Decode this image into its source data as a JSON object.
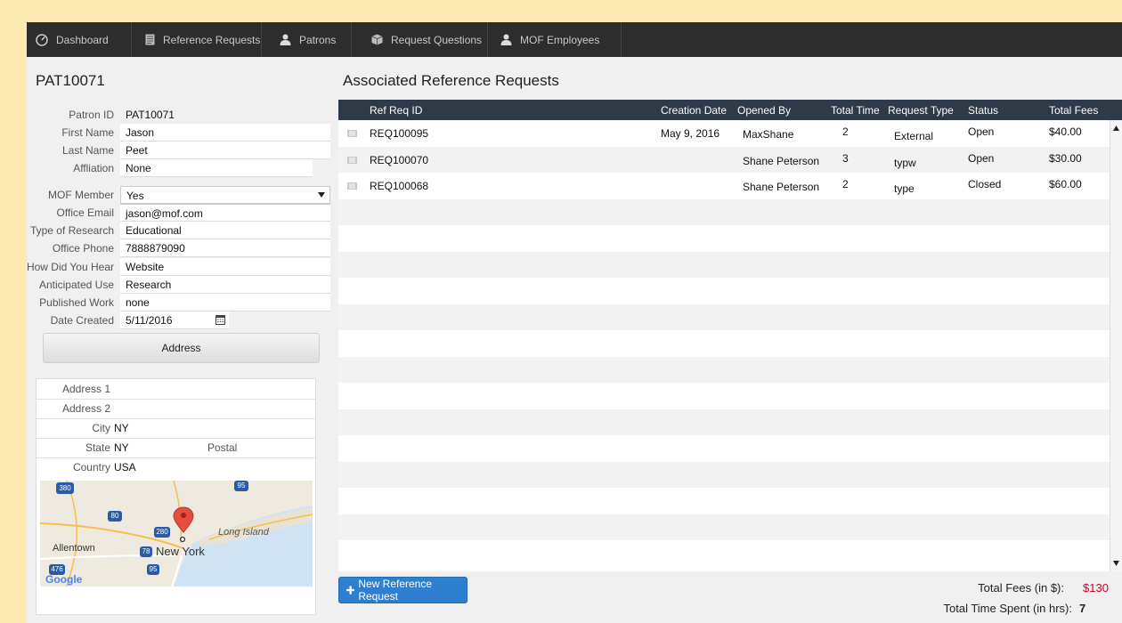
{
  "nav": {
    "items": [
      {
        "label": "Dashboard",
        "icon": "dashboard-icon"
      },
      {
        "label": "Reference Requests",
        "icon": "document-icon"
      },
      {
        "label": "Patrons",
        "icon": "person-icon"
      },
      {
        "label": "Request Questions",
        "icon": "box-icon"
      },
      {
        "label": "MOF Employees",
        "icon": "person-icon"
      }
    ]
  },
  "patron": {
    "title": "PAT10071",
    "fields": [
      {
        "label": "Patron ID",
        "value": "PAT10071"
      },
      {
        "label": "First Name",
        "value": "Jason"
      },
      {
        "label": "Last Name",
        "value": "Peet"
      },
      {
        "label": "Affliation",
        "value": "None"
      },
      {
        "label": "MOF Member",
        "value": "Yes"
      },
      {
        "label": "Office Email",
        "value": "jason@mof.com"
      },
      {
        "label": "Type of Research",
        "value": "Educational"
      },
      {
        "label": "Office Phone",
        "value": "7888879090"
      },
      {
        "label": "How Did You Hear",
        "value": "Website"
      },
      {
        "label": "Anticipated Use",
        "value": "Research"
      },
      {
        "label": "Published Work",
        "value": "none"
      },
      {
        "label": "Date Created",
        "value": "5/11/2016"
      }
    ],
    "address_button": "Address",
    "address": {
      "address1_label": "Address 1",
      "address1": "",
      "address2_label": "Address 2",
      "address2": "",
      "city_label": "City",
      "city": "NY",
      "state_label": "State",
      "state": "NY",
      "postal_label": "Postal",
      "postal": "",
      "country_label": "Country",
      "country": "USA"
    },
    "map": {
      "labels": [
        "Allentown",
        "New York",
        "Long Island",
        "Google"
      ],
      "shields": [
        "380",
        "95",
        "80",
        "280",
        "78",
        "476",
        "95"
      ]
    }
  },
  "requests": {
    "title": "Associated Reference Requests",
    "columns": [
      "Ref Req ID",
      "Creation Date",
      "Opened By",
      "Total Time",
      "Request Type",
      "Status",
      "Total Fees"
    ],
    "rows": [
      [
        "REQ100095",
        "May 9, 2016",
        "MaxShane",
        "2",
        "External",
        "Open",
        "$40.00"
      ],
      [
        "REQ100070",
        "",
        "Shane Peterson",
        "3",
        "typw",
        "Open",
        "$30.00"
      ],
      [
        "REQ100068",
        "",
        "Shane Peterson",
        "2",
        "type",
        "Closed",
        "$60.00"
      ]
    ],
    "new_button": "New Reference Request",
    "totals": {
      "fees_label": "Total Fees (in $):",
      "fees_value": "$130",
      "time_label": "Total Time Spent (in hrs):",
      "time_value": "7"
    }
  },
  "colors": {
    "accent": "#2f7fd1",
    "fees_value": "#d0021b",
    "nav_bg": "#2d2d2d",
    "grid_header": "#2e3a4a",
    "page_bg": "#fde9b2"
  }
}
